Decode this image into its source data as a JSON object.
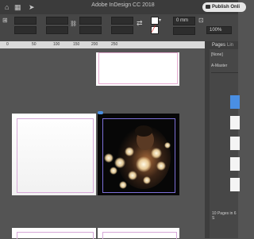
{
  "app": {
    "title": "Adobe InDesign CC 2018",
    "publish_label": "Publish Onli"
  },
  "control_bar": {
    "zoom": "0 mm",
    "zoom_percent": "100%"
  },
  "ruler": {
    "ticks": [
      "0",
      "50",
      "100",
      "150",
      "200",
      "250"
    ]
  },
  "pages_panel": {
    "tabs": [
      "Pages",
      "Lin"
    ],
    "none_label": "[None]",
    "master_label": "A-Master",
    "status": "10 Pages in 6 S"
  },
  "colors": {
    "accent": "#4a8fe3",
    "panel": "#474747",
    "pasteboard": "#545454"
  },
  "icons": [
    "home-icon",
    "arrow-icon",
    "rect-icon",
    "flip-icon",
    "frame-icon"
  ]
}
